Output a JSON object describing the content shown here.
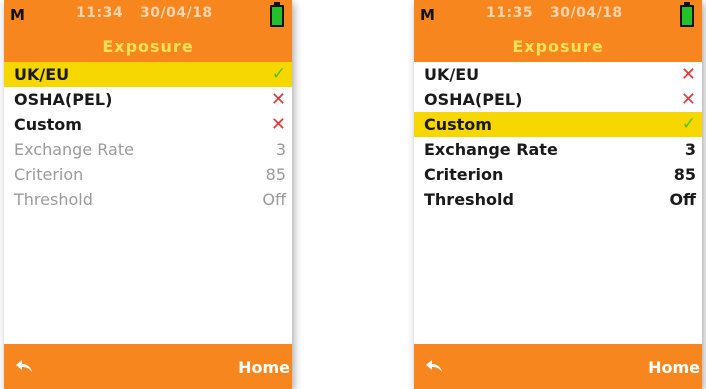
{
  "screens": [
    {
      "mode": "M",
      "time": "11:34",
      "date": "30/04/18",
      "title": "Exposure",
      "rows": [
        {
          "label": "UK/EU",
          "value_icon": "check-icon"
        },
        {
          "label": "OSHA(PEL)",
          "value_icon": "cross-icon"
        },
        {
          "label": "Custom",
          "value_icon": "cross-icon"
        },
        {
          "label": "Exchange Rate",
          "value": "3"
        },
        {
          "label": "Criterion",
          "value": "85"
        },
        {
          "label": "Threshold",
          "value": "Off"
        }
      ],
      "selected_row": "UK/EU",
      "home_label": "Home"
    },
    {
      "mode": "M",
      "time": "11:35",
      "date": "30/04/18",
      "title": "Exposure",
      "rows": [
        {
          "label": "UK/EU",
          "value_icon": "cross-icon"
        },
        {
          "label": "OSHA(PEL)",
          "value_icon": "cross-icon"
        },
        {
          "label": "Custom",
          "value_icon": "check-icon"
        },
        {
          "label": "Exchange Rate",
          "value": "3"
        },
        {
          "label": "Criterion",
          "value": "85"
        },
        {
          "label": "Threshold",
          "value": "Off"
        }
      ],
      "selected_row": "Custom",
      "home_label": "Home"
    }
  ],
  "colors": {
    "header_orange": "#f7861e",
    "selected_yellow": "#f6d700",
    "title_yellow": "#ffe15a",
    "check_green": "#4cc52a",
    "cross_red": "#ea3636",
    "disabled_gray": "#9a9a9a"
  },
  "icons": {
    "check": "✓",
    "cross": "✕",
    "battery": "battery-icon",
    "back": "back-arrow-icon"
  }
}
